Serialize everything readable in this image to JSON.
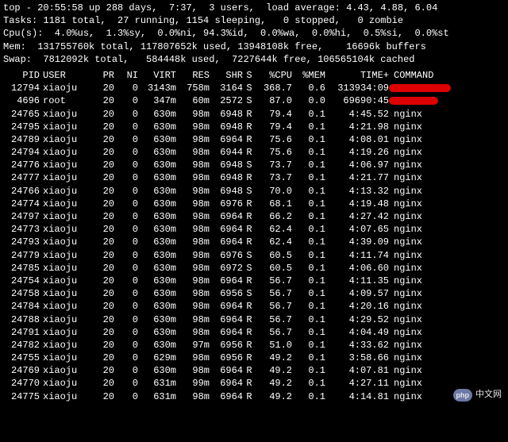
{
  "summary": {
    "line1": "top - 20:55:58 up 288 days,  7:37,  3 users,  load average: 4.43, 4.88, 6.04",
    "line2": "Tasks: 1181 total,  27 running, 1154 sleeping,   0 stopped,   0 zombie",
    "line3": "Cpu(s):  4.0%us,  1.3%sy,  0.0%ni, 94.3%id,  0.0%wa,  0.0%hi,  0.5%si,  0.0%st",
    "line4": "Mem:  131755760k total, 117807652k used, 13948108k free,    16696k buffers",
    "line5": "Swap:  7812092k total,   584448k used,  7227644k free, 106565104k cached"
  },
  "headers": {
    "pid": "PID",
    "user": "USER",
    "pr": "PR",
    "ni": "NI",
    "virt": "VIRT",
    "res": "RES",
    "shr": "SHR",
    "s": "S",
    "cpu": "%CPU",
    "mem": "%MEM",
    "time": "TIME+",
    "cmd": "COMMAND"
  },
  "processes": [
    {
      "pid": "12794",
      "user": "xiaoju",
      "pr": "20",
      "ni": "0",
      "virt": "3143m",
      "res": "758m",
      "shr": "3164",
      "s": "S",
      "cpu": "368.7",
      "mem": "0.6",
      "time": "313934:09",
      "cmd": "",
      "redacted": true
    },
    {
      "pid": "4696",
      "user": "root",
      "pr": "20",
      "ni": "0",
      "virt": "347m",
      "res": "60m",
      "shr": "2572",
      "s": "S",
      "cpu": "87.0",
      "mem": "0.0",
      "time": "69690:45",
      "cmd": "",
      "redacted": true
    },
    {
      "pid": "24765",
      "user": "xiaoju",
      "pr": "20",
      "ni": "0",
      "virt": "630m",
      "res": "98m",
      "shr": "6948",
      "s": "R",
      "cpu": "79.4",
      "mem": "0.1",
      "time": "4:45.52",
      "cmd": "nginx"
    },
    {
      "pid": "24795",
      "user": "xiaoju",
      "pr": "20",
      "ni": "0",
      "virt": "630m",
      "res": "98m",
      "shr": "6948",
      "s": "R",
      "cpu": "79.4",
      "mem": "0.1",
      "time": "4:21.98",
      "cmd": "nginx"
    },
    {
      "pid": "24789",
      "user": "xiaoju",
      "pr": "20",
      "ni": "0",
      "virt": "630m",
      "res": "98m",
      "shr": "6964",
      "s": "R",
      "cpu": "75.6",
      "mem": "0.1",
      "time": "4:08.01",
      "cmd": "nginx"
    },
    {
      "pid": "24794",
      "user": "xiaoju",
      "pr": "20",
      "ni": "0",
      "virt": "630m",
      "res": "98m",
      "shr": "6944",
      "s": "R",
      "cpu": "75.6",
      "mem": "0.1",
      "time": "4:19.26",
      "cmd": "nginx"
    },
    {
      "pid": "24776",
      "user": "xiaoju",
      "pr": "20",
      "ni": "0",
      "virt": "630m",
      "res": "98m",
      "shr": "6948",
      "s": "S",
      "cpu": "73.7",
      "mem": "0.1",
      "time": "4:06.97",
      "cmd": "nginx"
    },
    {
      "pid": "24777",
      "user": "xiaoju",
      "pr": "20",
      "ni": "0",
      "virt": "630m",
      "res": "98m",
      "shr": "6948",
      "s": "R",
      "cpu": "73.7",
      "mem": "0.1",
      "time": "4:21.77",
      "cmd": "nginx"
    },
    {
      "pid": "24766",
      "user": "xiaoju",
      "pr": "20",
      "ni": "0",
      "virt": "630m",
      "res": "98m",
      "shr": "6948",
      "s": "S",
      "cpu": "70.0",
      "mem": "0.1",
      "time": "4:13.32",
      "cmd": "nginx"
    },
    {
      "pid": "24774",
      "user": "xiaoju",
      "pr": "20",
      "ni": "0",
      "virt": "630m",
      "res": "98m",
      "shr": "6976",
      "s": "R",
      "cpu": "68.1",
      "mem": "0.1",
      "time": "4:19.48",
      "cmd": "nginx"
    },
    {
      "pid": "24797",
      "user": "xiaoju",
      "pr": "20",
      "ni": "0",
      "virt": "630m",
      "res": "98m",
      "shr": "6964",
      "s": "R",
      "cpu": "66.2",
      "mem": "0.1",
      "time": "4:27.42",
      "cmd": "nginx"
    },
    {
      "pid": "24773",
      "user": "xiaoju",
      "pr": "20",
      "ni": "0",
      "virt": "630m",
      "res": "98m",
      "shr": "6964",
      "s": "R",
      "cpu": "62.4",
      "mem": "0.1",
      "time": "4:07.65",
      "cmd": "nginx"
    },
    {
      "pid": "24793",
      "user": "xiaoju",
      "pr": "20",
      "ni": "0",
      "virt": "630m",
      "res": "98m",
      "shr": "6964",
      "s": "R",
      "cpu": "62.4",
      "mem": "0.1",
      "time": "4:39.09",
      "cmd": "nginx"
    },
    {
      "pid": "24779",
      "user": "xiaoju",
      "pr": "20",
      "ni": "0",
      "virt": "630m",
      "res": "98m",
      "shr": "6976",
      "s": "S",
      "cpu": "60.5",
      "mem": "0.1",
      "time": "4:11.74",
      "cmd": "nginx"
    },
    {
      "pid": "24785",
      "user": "xiaoju",
      "pr": "20",
      "ni": "0",
      "virt": "630m",
      "res": "98m",
      "shr": "6972",
      "s": "S",
      "cpu": "60.5",
      "mem": "0.1",
      "time": "4:06.60",
      "cmd": "nginx"
    },
    {
      "pid": "24754",
      "user": "xiaoju",
      "pr": "20",
      "ni": "0",
      "virt": "630m",
      "res": "98m",
      "shr": "6964",
      "s": "R",
      "cpu": "56.7",
      "mem": "0.1",
      "time": "4:11.35",
      "cmd": "nginx"
    },
    {
      "pid": "24758",
      "user": "xiaoju",
      "pr": "20",
      "ni": "0",
      "virt": "630m",
      "res": "98m",
      "shr": "6956",
      "s": "S",
      "cpu": "56.7",
      "mem": "0.1",
      "time": "4:09.57",
      "cmd": "nginx"
    },
    {
      "pid": "24784",
      "user": "xiaoju",
      "pr": "20",
      "ni": "0",
      "virt": "630m",
      "res": "98m",
      "shr": "6964",
      "s": "R",
      "cpu": "56.7",
      "mem": "0.1",
      "time": "4:20.16",
      "cmd": "nginx"
    },
    {
      "pid": "24788",
      "user": "xiaoju",
      "pr": "20",
      "ni": "0",
      "virt": "630m",
      "res": "98m",
      "shr": "6964",
      "s": "R",
      "cpu": "56.7",
      "mem": "0.1",
      "time": "4:29.52",
      "cmd": "nginx"
    },
    {
      "pid": "24791",
      "user": "xiaoju",
      "pr": "20",
      "ni": "0",
      "virt": "630m",
      "res": "98m",
      "shr": "6964",
      "s": "R",
      "cpu": "56.7",
      "mem": "0.1",
      "time": "4:04.49",
      "cmd": "nginx"
    },
    {
      "pid": "24782",
      "user": "xiaoju",
      "pr": "20",
      "ni": "0",
      "virt": "630m",
      "res": "97m",
      "shr": "6956",
      "s": "R",
      "cpu": "51.0",
      "mem": "0.1",
      "time": "4:33.62",
      "cmd": "nginx"
    },
    {
      "pid": "24755",
      "user": "xiaoju",
      "pr": "20",
      "ni": "0",
      "virt": "629m",
      "res": "98m",
      "shr": "6956",
      "s": "R",
      "cpu": "49.2",
      "mem": "0.1",
      "time": "3:58.66",
      "cmd": "nginx"
    },
    {
      "pid": "24769",
      "user": "xiaoju",
      "pr": "20",
      "ni": "0",
      "virt": "630m",
      "res": "98m",
      "shr": "6964",
      "s": "R",
      "cpu": "49.2",
      "mem": "0.1",
      "time": "4:07.81",
      "cmd": "nginx"
    },
    {
      "pid": "24770",
      "user": "xiaoju",
      "pr": "20",
      "ni": "0",
      "virt": "631m",
      "res": "99m",
      "shr": "6964",
      "s": "R",
      "cpu": "49.2",
      "mem": "0.1",
      "time": "4:27.11",
      "cmd": "nginx"
    },
    {
      "pid": "24775",
      "user": "xiaoju",
      "pr": "20",
      "ni": "0",
      "virt": "631m",
      "res": "98m",
      "shr": "6964",
      "s": "R",
      "cpu": "49.2",
      "mem": "0.1",
      "time": "4:14.81",
      "cmd": "nginx"
    }
  ],
  "watermark": {
    "icon": "php",
    "text": "中文网"
  }
}
